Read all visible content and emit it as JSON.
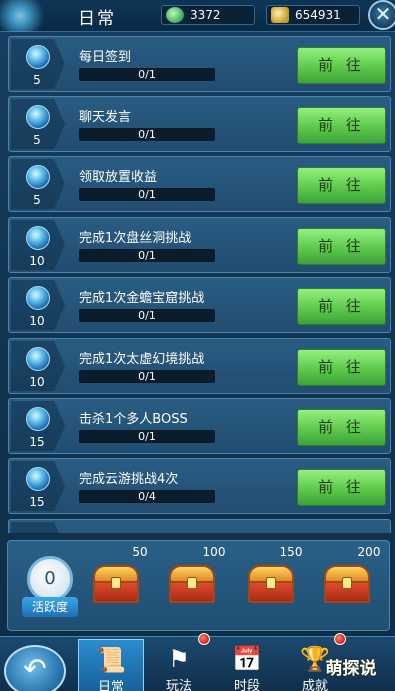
{
  "header": {
    "title": "日常",
    "currency1": "3372",
    "currency2": "654931",
    "close_label": "✕"
  },
  "tasks": [
    {
      "name": "每日签到",
      "points": "5",
      "progress": "0/1",
      "action": "前 往"
    },
    {
      "name": "聊天发言",
      "points": "5",
      "progress": "0/1",
      "action": "前 往"
    },
    {
      "name": "领取放置收益",
      "points": "5",
      "progress": "0/1",
      "action": "前 往"
    },
    {
      "name": "完成1次盘丝洞挑战",
      "points": "10",
      "progress": "0/1",
      "action": "前 往"
    },
    {
      "name": "完成1次金蟾宝窟挑战",
      "points": "10",
      "progress": "0/1",
      "action": "前 往"
    },
    {
      "name": "完成1次太虚幻境挑战",
      "points": "10",
      "progress": "0/1",
      "action": "前 往"
    },
    {
      "name": "击杀1个多人BOSS",
      "points": "15",
      "progress": "0/1",
      "action": "前 往"
    },
    {
      "name": "完成云游挑战4次",
      "points": "15",
      "progress": "0/4",
      "action": "前 往"
    }
  ],
  "activity": {
    "value": "0",
    "label": "活跃度",
    "milestones": [
      "50",
      "100",
      "150",
      "200"
    ]
  },
  "bottom_tabs": [
    {
      "label": "日常",
      "icon": "scroll-icon"
    },
    {
      "label": "玩法",
      "icon": "flag-icon"
    },
    {
      "label": "时段",
      "icon": "calendar-icon"
    },
    {
      "label": "成就",
      "icon": "trophy-icon"
    }
  ],
  "watermark": "萌探说",
  "colors": {
    "accent": "#3fb2ea",
    "go_button": "#5ec94b",
    "panel": "#214d70"
  }
}
